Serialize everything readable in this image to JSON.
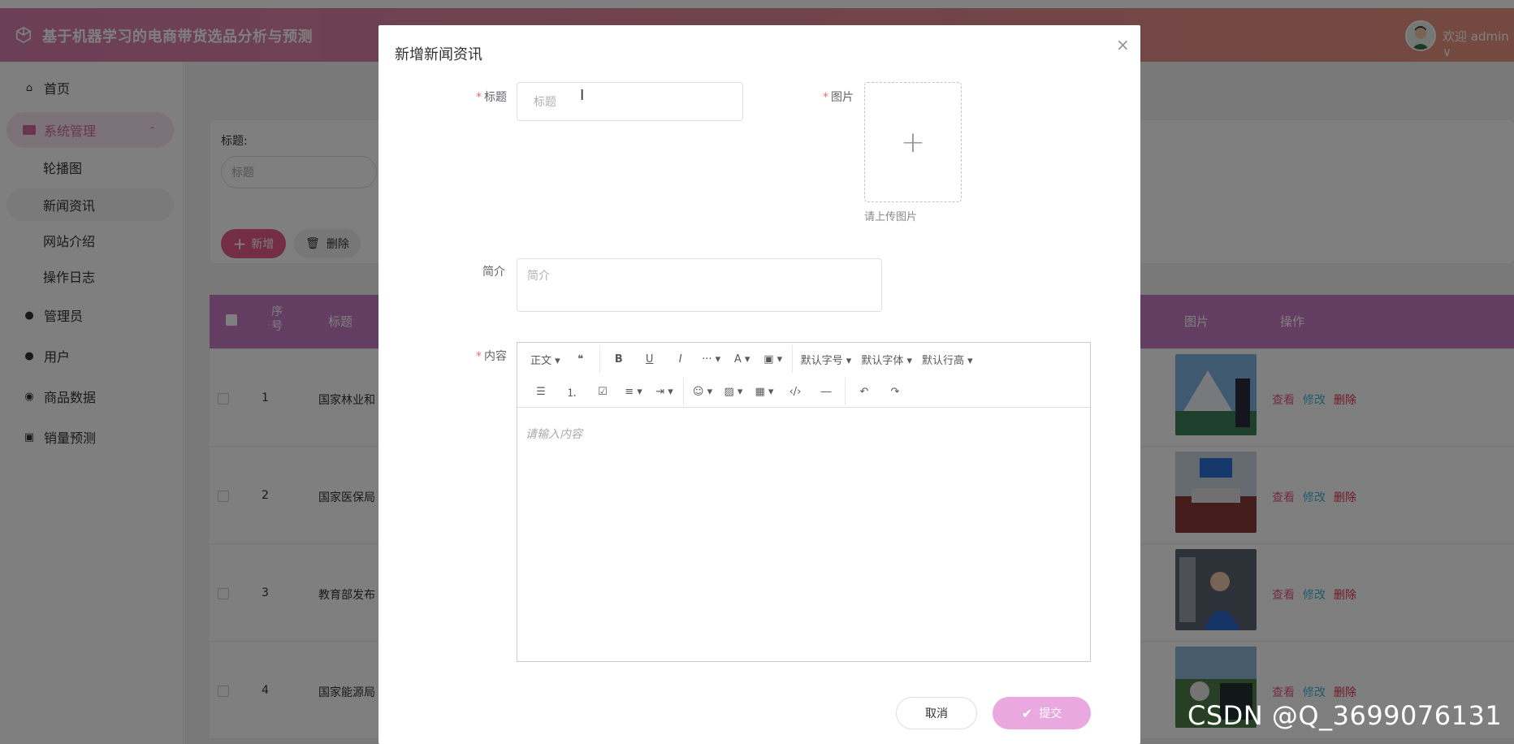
{
  "header": {
    "app_title": "基于机器学习的电商带货选品分析与预测",
    "welcome": "欢迎 admin ∨"
  },
  "sidebar": {
    "home": "首页",
    "system_group": "系统管理",
    "sub_items": [
      "轮播图",
      "新闻资讯",
      "网站介绍",
      "操作日志"
    ],
    "items": [
      "管理员",
      "用户",
      "商品数据",
      "销量预测"
    ]
  },
  "list_page": {
    "search_label": "标题:",
    "search_placeholder": "标题",
    "add_button": "新增",
    "delete_button": "删除",
    "columns": [
      "序号",
      "标题",
      "图片",
      "操作"
    ],
    "rows": [
      {
        "index": "1",
        "title": "国家林业和"
      },
      {
        "index": "2",
        "title": "国家医保局"
      },
      {
        "index": "3",
        "title": "教育部发布"
      },
      {
        "index": "4",
        "title": "国家能源局"
      }
    ],
    "op_view": "查看",
    "op_edit": "修改",
    "op_delete": "删除"
  },
  "dialog": {
    "title": "新增新闻资讯",
    "label_title": "标题",
    "title_placeholder": "标题",
    "label_image": "图片",
    "upload_tip": "请上传图片",
    "label_intro": "简介",
    "intro_placeholder": "简介",
    "label_content": "内容",
    "editor_placeholder": "请输入内容",
    "toolbar_row1": [
      "正文 ▾",
      "❝",
      "B",
      "U",
      "I",
      "··· ▾",
      "A ▾",
      "▣ ▾",
      "默认字号 ▾",
      "默认字体 ▾",
      "默认行高 ▾"
    ],
    "toolbar_row2": [
      "☰",
      "⒈",
      "☑",
      "≡ ▾",
      "⇥ ▾",
      "☺ ▾",
      "▨ ▾",
      "▦ ▾",
      "‹/›",
      "―",
      "↶",
      "↷"
    ],
    "cancel": "取消",
    "submit": "提交"
  },
  "watermark": "CSDN @Q_3699076131"
}
